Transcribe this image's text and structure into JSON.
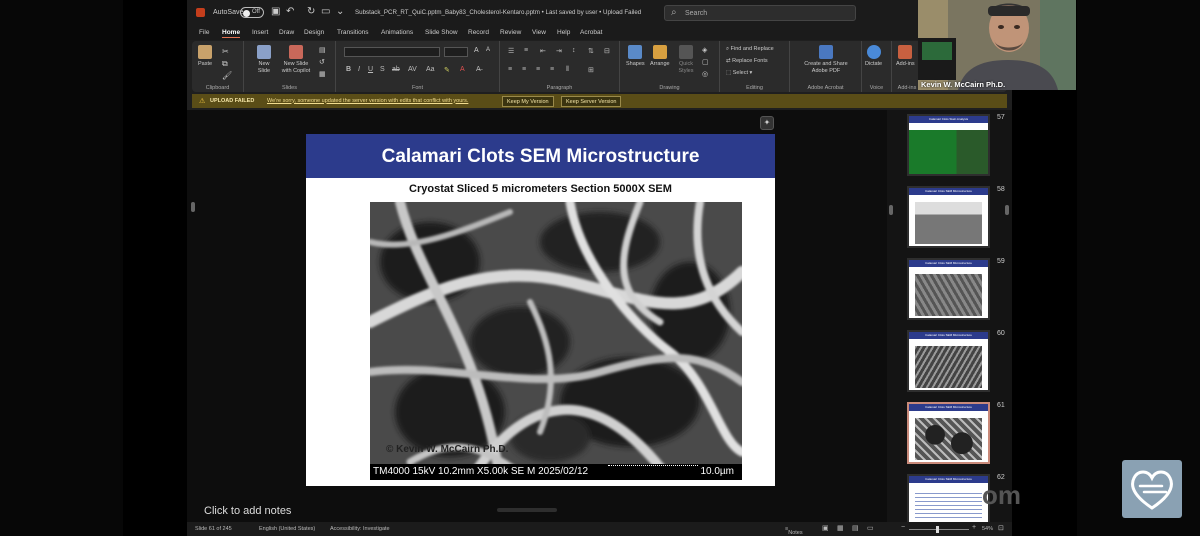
{
  "titlebar": {
    "autosave_label": "AutoSave",
    "autosave_state": "Off",
    "document_title": "Substack_PCR_RT_QuiC.pptm_Baby83_Cholesterol-Kentaro.pptm  •  Last saved by user  •  Upload Failed",
    "search_placeholder": "Search"
  },
  "tabs": [
    "File",
    "Home",
    "Insert",
    "Draw",
    "Design",
    "Transitions",
    "Animations",
    "Slide Show",
    "Record",
    "Review",
    "View",
    "Help",
    "Acrobat"
  ],
  "active_tab": "Home",
  "ribbon": {
    "clipboard": {
      "paste": "Paste",
      "group": "Clipboard"
    },
    "slides": {
      "new_slide": "New Slide",
      "copilot": "New Slide with Copilot",
      "group": "Slides"
    },
    "font_group": "Font",
    "paragraph_group": "Paragraph",
    "drawing": {
      "shapes": "Shapes",
      "arrange": "Arrange",
      "quick_styles": "Quick Styles",
      "group": "Drawing"
    },
    "editing": {
      "find": "Find and Replace",
      "replace": "Replace Fonts",
      "select": "Select",
      "group": "Editing"
    },
    "acrobat": {
      "create": "Create and Share Adobe PDF",
      "group": "Adobe Acrobat"
    },
    "voice": {
      "dictate": "Dictate",
      "group": "Voice"
    },
    "addins": {
      "label": "Add-ins",
      "group": "Add-ins"
    }
  },
  "notification": {
    "label": "UPLOAD FAILED",
    "message": "We're sorry, someone updated the server version with edits that conflict with yours.",
    "keep_mine": "Keep My Version",
    "keep_server": "Keep Server Version"
  },
  "slide": {
    "title": "Calamari Clots SEM Microstructure",
    "subtitle": "Cryostat Sliced 5 micrometers Section 5000X SEM",
    "watermark": "© Kevin W. McCairn Ph.D.",
    "sem_info": "TM4000 15kV 10.2mm X5.00k SE M 2025/02/12",
    "scale_label": "10.0µm"
  },
  "notes_placeholder": "Click to add notes",
  "thumbnails": [
    {
      "number": "57",
      "title": "Calamari Clots Stain Analysis",
      "style": "green"
    },
    {
      "number": "58",
      "title": "Calamari Clots SEM Microstructure",
      "style": "gray"
    },
    {
      "number": "59",
      "title": "Calamari Clots SEM Microstructure",
      "style": "gray"
    },
    {
      "number": "60",
      "title": "Calamari Clots SEM Microstructure",
      "style": "gray"
    },
    {
      "number": "61",
      "title": "Calamari Clots SEM Microstructure",
      "style": "gray",
      "selected": true
    },
    {
      "number": "62",
      "title": "Calamari Clots SEM Microstructure",
      "style": "text"
    }
  ],
  "statusbar": {
    "slide_count": "Slide 61 of 245",
    "language": "English (United States)",
    "accessibility": "Accessibility: Investigate",
    "notes": "Notes",
    "zoom": "54%"
  },
  "webcam": {
    "caption": "Kevin W. McCairn Ph.D."
  },
  "overlay": {
    "zoom_text": "om"
  },
  "colors": {
    "accent": "#c43e1c",
    "slide_banner": "#2c3b8c",
    "notification_bg": "#5a4d17"
  }
}
